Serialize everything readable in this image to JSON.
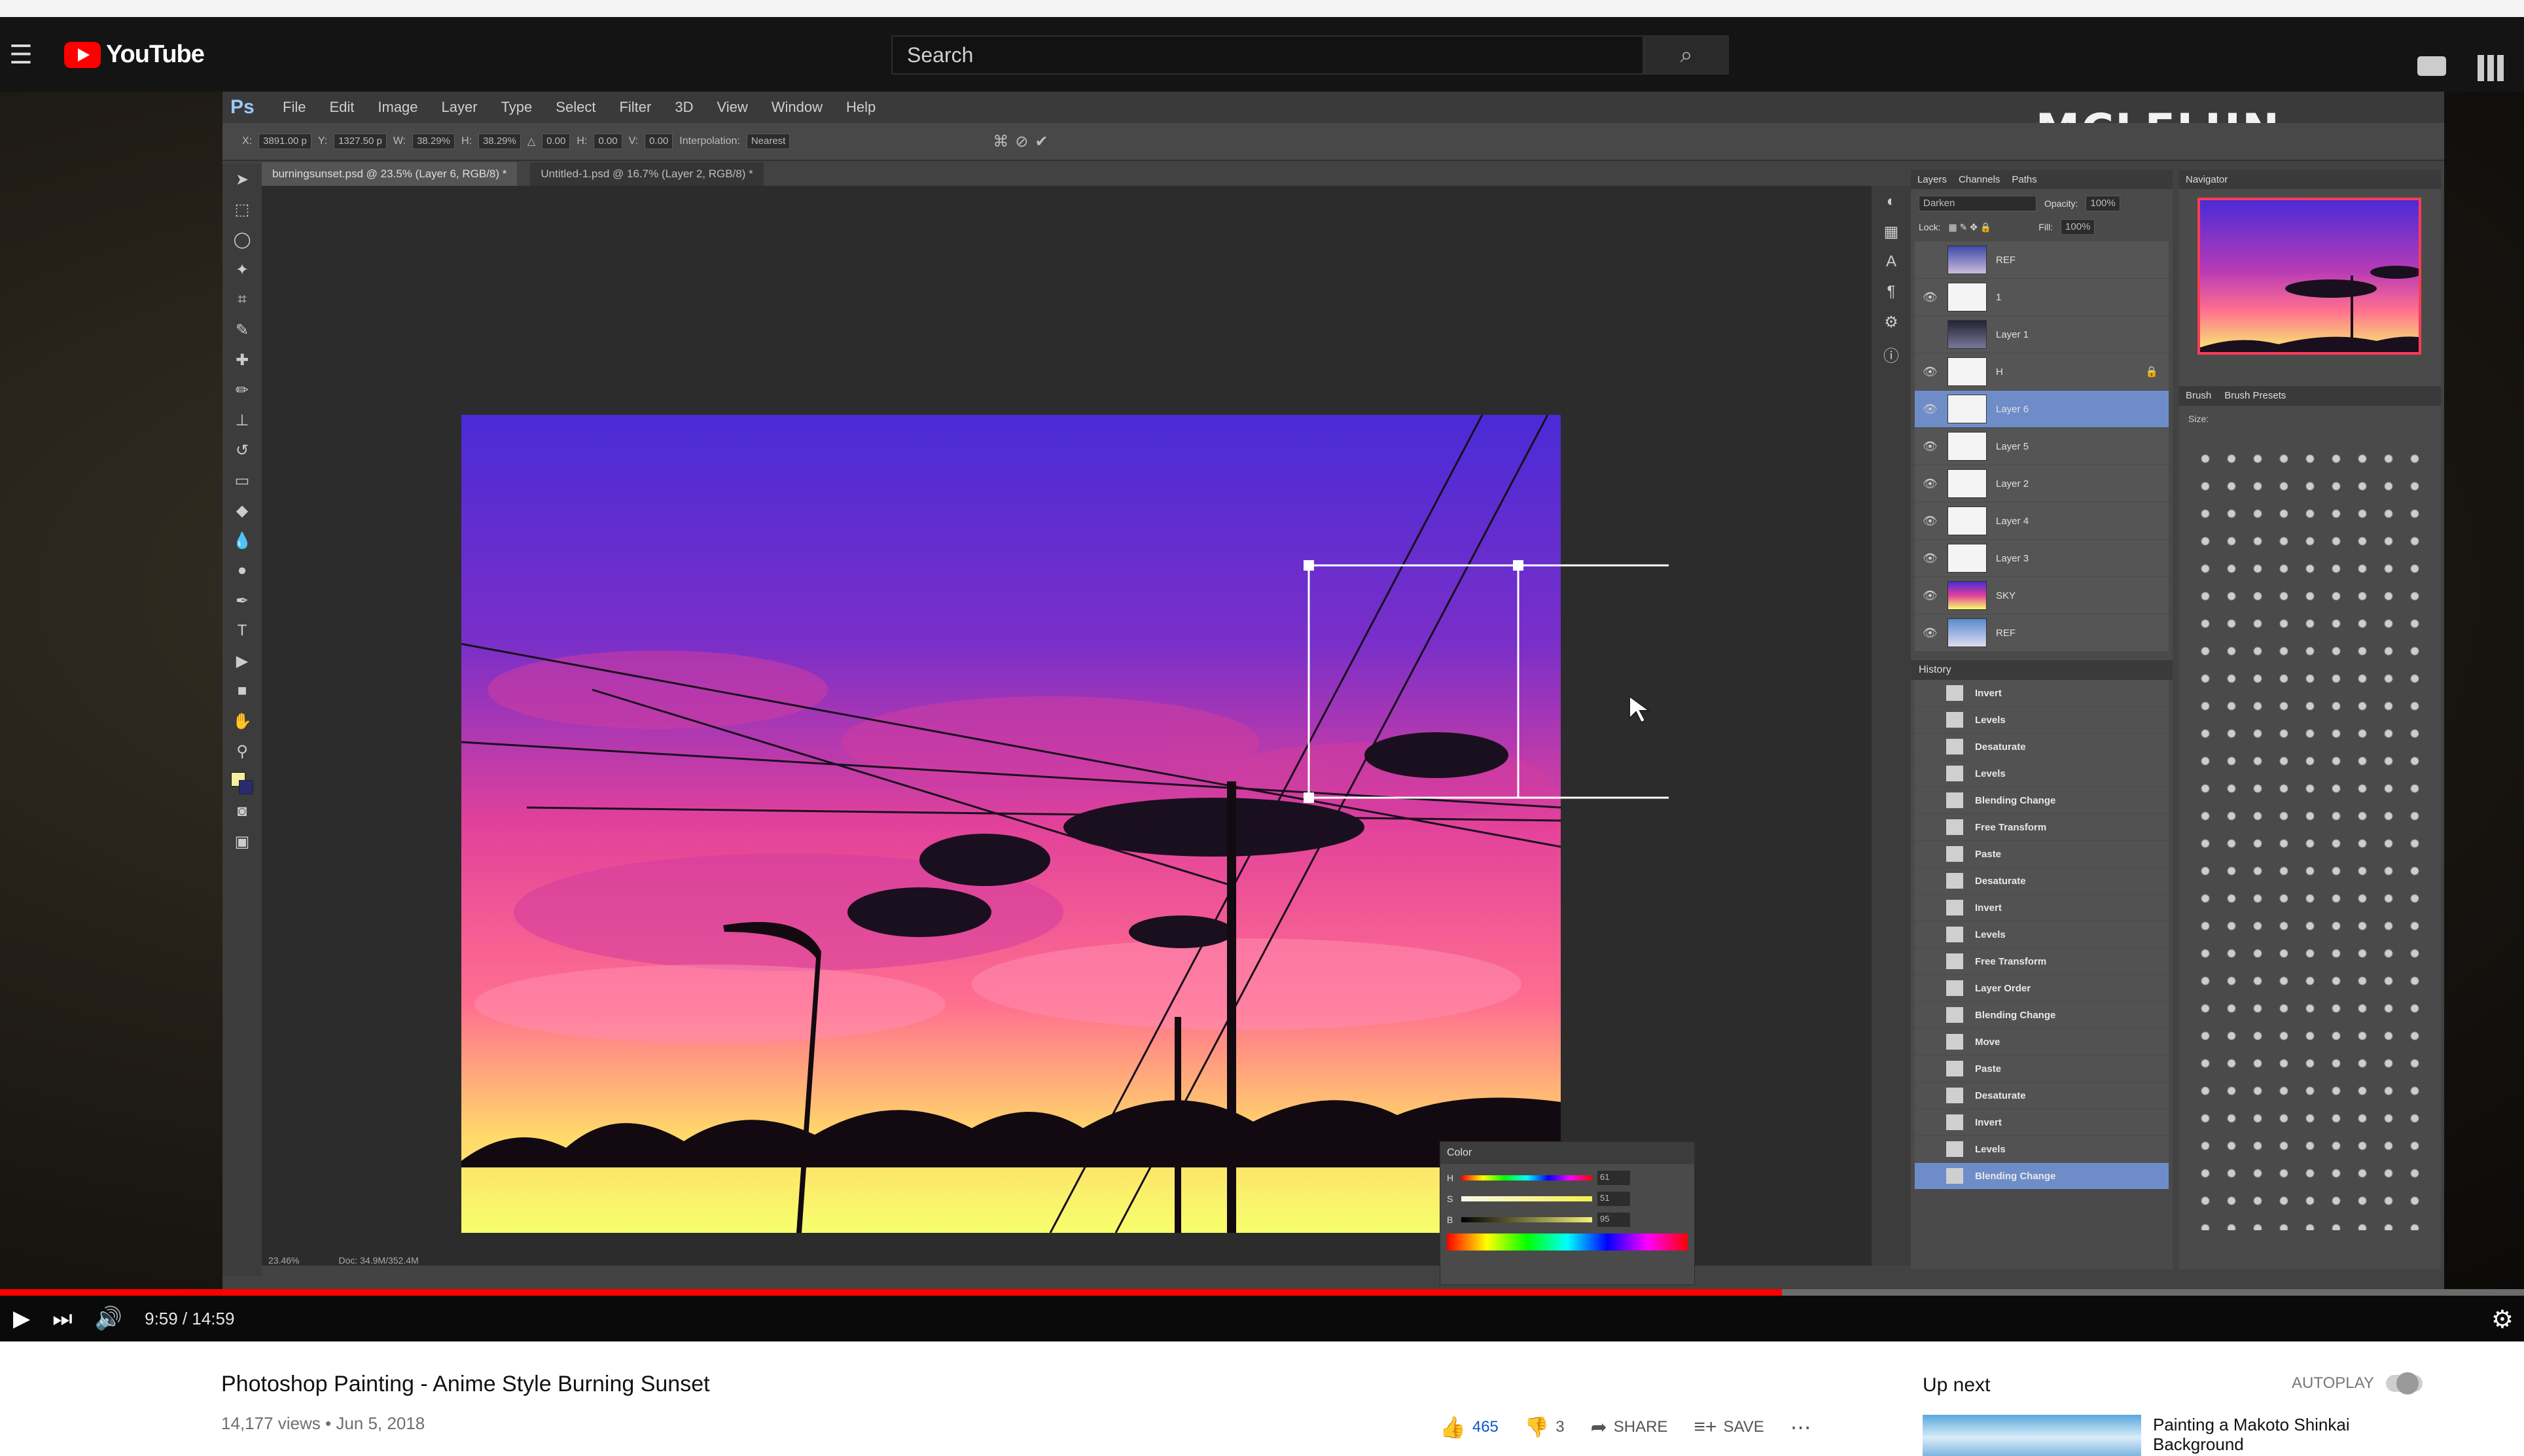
{
  "youtube": {
    "logo_text": "YouTube",
    "search_placeholder": "Search",
    "icons": [
      "menu-icon",
      "search-icon",
      "camera-icon",
      "apps-icon"
    ]
  },
  "photoshop": {
    "logo": "Ps",
    "menu": [
      "File",
      "Edit",
      "Image",
      "Layer",
      "Type",
      "Select",
      "Filter",
      "3D",
      "View",
      "Window",
      "Help"
    ],
    "brand": "MCLELUN",
    "options": {
      "x": "3891.00 p",
      "y": "1327.50 p",
      "w": "38.29%",
      "h": "38.29%",
      "angle": "0.00",
      "h_skew": "0.00",
      "v_skew": "0.00",
      "interpolation_label": "Interpolation:",
      "interpolation_value": "Nearest"
    },
    "doc_tabs": [
      "burningsunset.psd @ 23.5% (Layer 6, RGB/8) *",
      "Untitled-1.psd @ 16.7% (Layer 2, RGB/8) *"
    ],
    "layers_panel": {
      "tabs": [
        "Layers",
        "Channels",
        "Paths"
      ],
      "blend_mode": "Darken",
      "opacity_label": "Opacity:",
      "opacity": "100%",
      "lock_label": "Lock:",
      "fill_label": "Fill:",
      "fill": "100%",
      "layers": [
        "REF",
        "1",
        "Layer 1",
        "H",
        "Layer 6",
        "Layer 5",
        "Layer 2",
        "Layer 4",
        "Layer 3",
        "SKY",
        "REF"
      ],
      "selected_index": 4
    },
    "history_panel": {
      "title": "History",
      "items": [
        "Invert",
        "Levels",
        "Desaturate",
        "Levels",
        "Blending Change",
        "Free Transform",
        "Paste",
        "Desaturate",
        "Invert",
        "Levels",
        "Free Transform",
        "Layer Order",
        "Blending Change",
        "Move",
        "Paste",
        "Desaturate",
        "Invert",
        "Levels",
        "Blending Change"
      ],
      "selected_index": 18
    },
    "navigator": {
      "title": "Navigator"
    },
    "brush_panel": {
      "tabs": [
        "Brush",
        "Brush Presets"
      ],
      "size_label": "Size:"
    },
    "color_panel": {
      "title": "Color",
      "sliders": [
        {
          "label": "H",
          "value": "61"
        },
        {
          "label": "S",
          "value": "51"
        },
        {
          "label": "B",
          "value": "95"
        }
      ],
      "foreground": "#f4f0a0",
      "background": "#2a2a6e"
    },
    "status": {
      "zoom": "23.46%",
      "doc": "Doc: 34.9M/352.4M"
    }
  },
  "player": {
    "time": "9:59 / 14:59",
    "progress_fraction": 0.706,
    "buffered_fraction": 0.87
  },
  "video": {
    "title": "Photoshop Painting - Anime Style Burning Sunset",
    "views": "14,177 views",
    "date": "Jun 5, 2018",
    "likes": "465",
    "dislikes": "3",
    "share": "SHARE",
    "save": "SAVE",
    "more": "⋯"
  },
  "sidebar": {
    "up_next": "Up next",
    "autoplay": "AUTOPLAY",
    "next_title": "Painting a Makoto Shinkai Background"
  },
  "colors": {
    "youtube_red": "#ff0000",
    "like_blue": "#0a58c7",
    "ps_selection": "#6e8dc8"
  }
}
